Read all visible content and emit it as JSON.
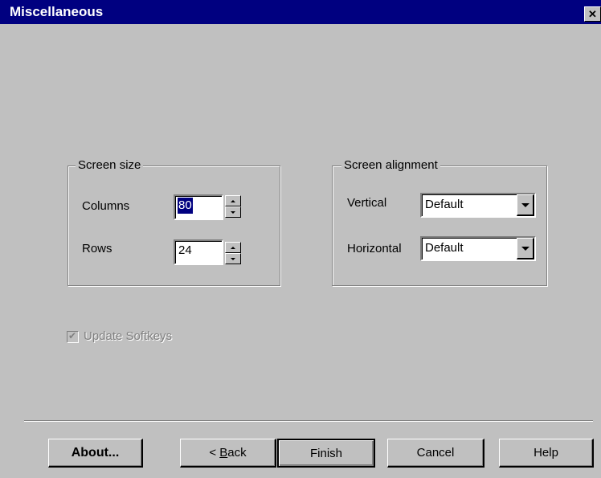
{
  "window": {
    "title": "Miscellaneous",
    "close_symbol": "✕"
  },
  "screen_size": {
    "legend": "Screen size",
    "columns_label": "Columns",
    "columns_value": "80",
    "rows_label": "Rows",
    "rows_value": "24"
  },
  "screen_alignment": {
    "legend": "Screen alignment",
    "vertical_label": "Vertical",
    "vertical_value": "Default",
    "horizontal_label": "Horizontal",
    "horizontal_value": "Default"
  },
  "update_softkeys": {
    "label": "Update Softkeys",
    "checked": true,
    "enabled": false,
    "check_mark": "✔"
  },
  "buttons": {
    "about": "About...",
    "back_prefix": "< ",
    "back_mnemonic": "B",
    "back_rest": "ack",
    "finish": "Finish",
    "cancel": "Cancel",
    "help": "Help"
  },
  "colors": {
    "titlebar": "#000080",
    "face": "#c0c0c0",
    "selection": "#000080"
  }
}
